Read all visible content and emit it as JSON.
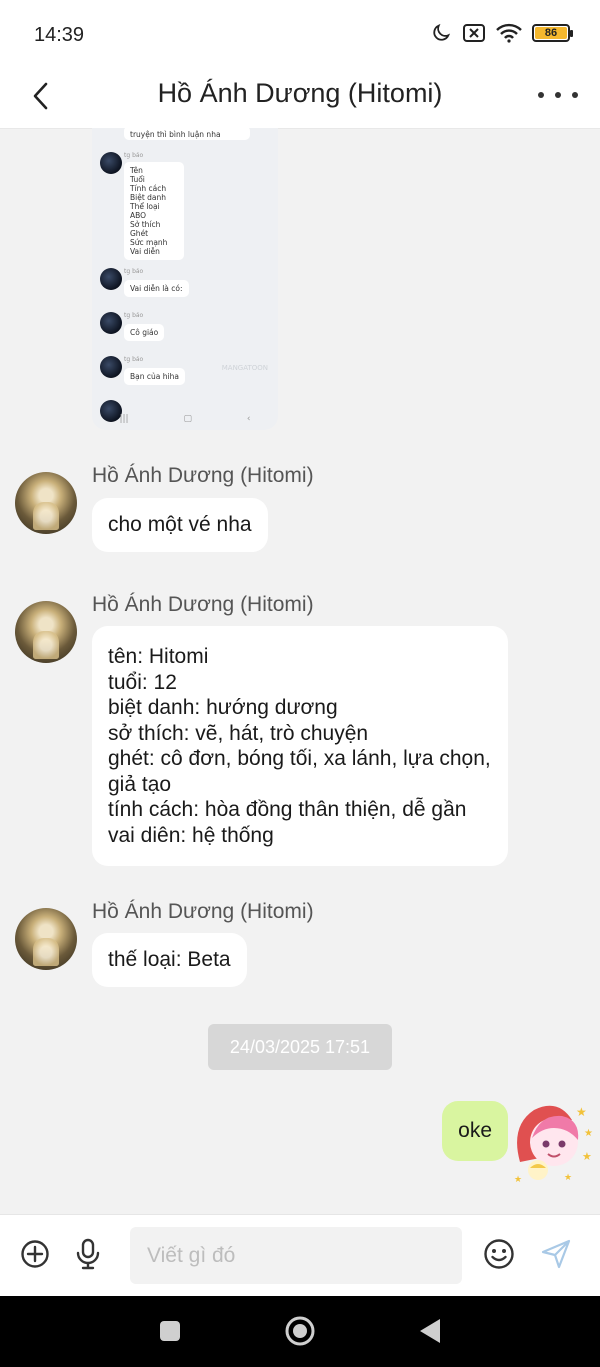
{
  "status_bar": {
    "time": "14:39",
    "battery": "86"
  },
  "header": {
    "title": "Hồ Ánh Dương (Hitomi)"
  },
  "shared_screenshot": {
    "top_text": "truyện thì bình luận nha",
    "name": "tg báo",
    "list_lines": [
      "Tên",
      "Tuổi",
      "Tính cách",
      "Biệt danh",
      "Thể loại ABO",
      "Sở thích",
      "Ghét",
      "Sức mạnh",
      "Vai diễn"
    ],
    "msg2": "Vai diễn là có:",
    "msg3": "Cô giáo",
    "msg4": "Bạn của hiha",
    "watermark": "MANGATOON"
  },
  "messages": [
    {
      "sender": "Hồ Ánh Dương (Hitomi)",
      "lines": [
        "cho một vé nha"
      ]
    },
    {
      "sender": "Hồ Ánh Dương (Hitomi)",
      "lines": [
        "tên: Hitomi",
        "tuổi: 12",
        "biệt danh: hướng dương",
        "sở thích: vẽ, hát, trò chuyện",
        "ghét: cô đơn, bóng tối, xa lánh, lựa chọn,",
        "giả tạo",
        "tính cách: hòa đồng thân thiện, dễ gần",
        "vai diên: hệ thống"
      ]
    },
    {
      "sender": "Hồ Ánh Dương (Hitomi)",
      "lines": [
        "thế loại: Beta"
      ]
    }
  ],
  "timestamp": "24/03/2025 17:51",
  "my_message": "oke",
  "composer": {
    "placeholder": "Viết gì đó"
  },
  "icons": [
    "moon-icon",
    "sim-off-icon",
    "wifi-icon",
    "battery-icon",
    "back-arrow-icon",
    "more-icon",
    "add-circle-icon",
    "microphone-icon",
    "emoji-icon",
    "send-icon",
    "recents-icon",
    "home-icon",
    "back-nav-icon"
  ],
  "colors": {
    "my_bubble": "#d9f5a0",
    "battery": "#f5b82e",
    "timestamp_bg": "#d7d7d7"
  }
}
